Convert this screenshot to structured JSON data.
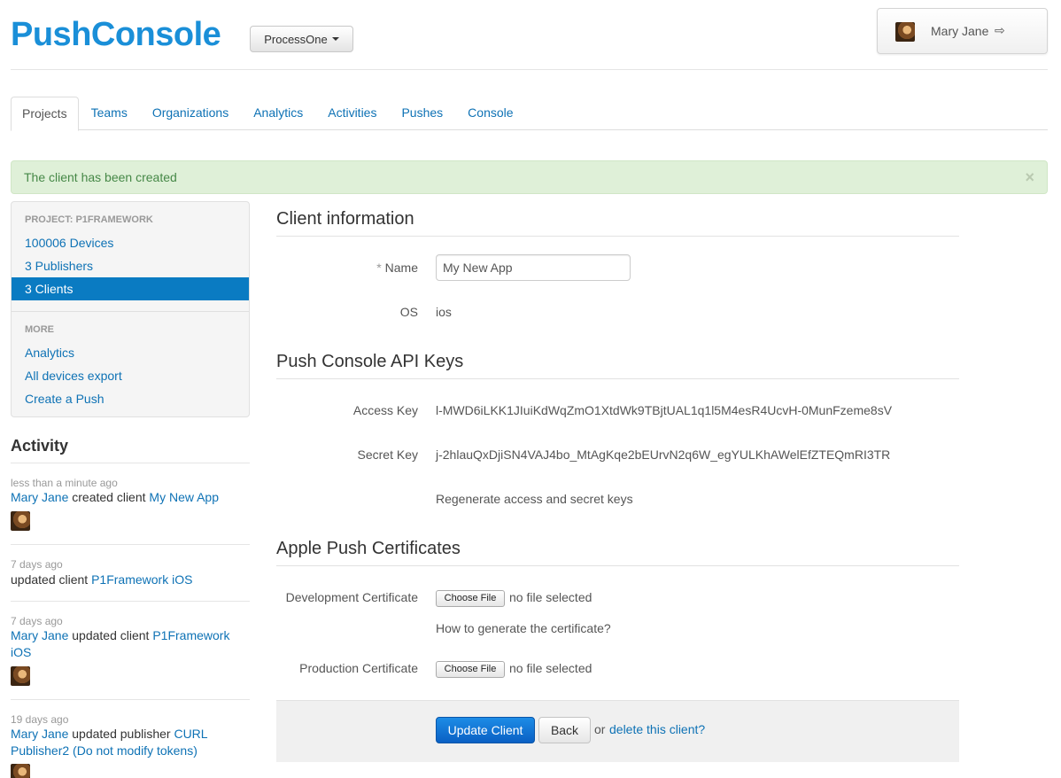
{
  "header": {
    "brand": "PushConsole",
    "org_selector": "ProcessOne",
    "user_name": "Mary Jane"
  },
  "tabs": [
    {
      "label": "Projects",
      "active": true
    },
    {
      "label": "Teams"
    },
    {
      "label": "Organizations"
    },
    {
      "label": "Analytics"
    },
    {
      "label": "Activities"
    },
    {
      "label": "Pushes"
    },
    {
      "label": "Console"
    }
  ],
  "alert": {
    "message": "The client has been created",
    "close": "×"
  },
  "sidebar": {
    "project_header": "PROJECT: P1FRAMEWORK",
    "project_items": [
      "100006 Devices",
      "3 Publishers",
      "3 Clients"
    ],
    "more_header": "MORE",
    "more_items": [
      "Analytics",
      "All devices export",
      "Create a Push"
    ]
  },
  "activity": {
    "title": "Activity",
    "entries": [
      {
        "time": "less than a minute ago",
        "user": "Mary Jane",
        "action": "created client",
        "target": "My New App"
      },
      {
        "time": "7 days ago",
        "user": "",
        "action": "updated client",
        "target": "P1Framework iOS"
      },
      {
        "time": "7 days ago",
        "user": "Mary Jane",
        "action": "updated client",
        "target": "P1Framework iOS"
      },
      {
        "time": "19 days ago",
        "user": "Mary Jane",
        "action": "updated publisher",
        "target": "CURL Publisher2 (Do not modify tokens)"
      }
    ]
  },
  "client_info": {
    "title": "Client information",
    "name_required": "*",
    "name_label": "Name",
    "name_value": "My New App",
    "os_label": "OS",
    "os_value": "ios"
  },
  "api_keys": {
    "title": "Push Console API Keys",
    "access_label": "Access Key",
    "access_value": "l-MWD6iLKK1JIuiKdWqZmO1XtdWk9TBjtUAL1q1l5M4esR4UcvH-0MunFzeme8sV",
    "secret_label": "Secret Key",
    "secret_value": "j-2hlauQxDjiSN4VAJ4bo_MtAgKqe2bEUrvN2q6W_egYULKhAWelEfZTEQmRI3TR",
    "regenerate_link": "Regenerate access and secret keys"
  },
  "certificates": {
    "title": "Apple Push Certificates",
    "dev_label": "Development Certificate",
    "prod_label": "Production Certificate",
    "choose_file": "Choose File",
    "no_file": "no file selected",
    "help_link": "How to generate the certificate?"
  },
  "actions": {
    "update": "Update Client",
    "back": "Back",
    "or": "or",
    "delete": "delete this client?"
  }
}
